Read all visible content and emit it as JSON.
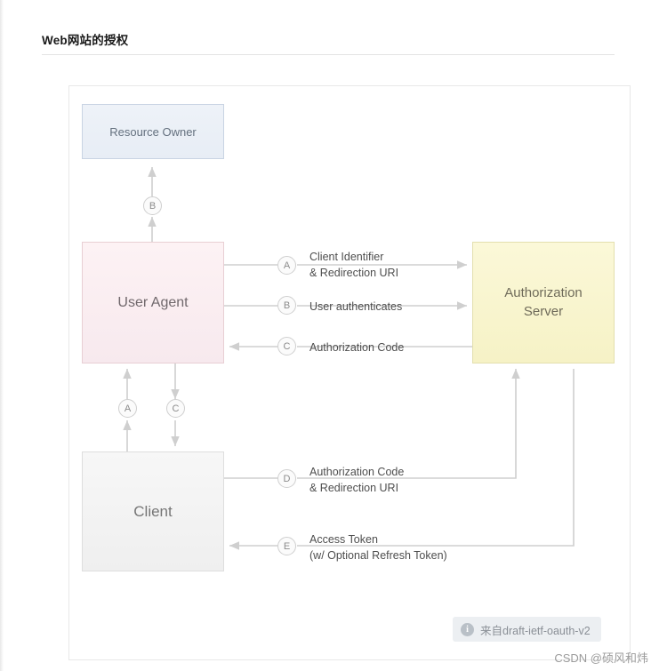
{
  "page": {
    "section_title": "Web网站的授权",
    "watermark": "CSDN @硕风和炜"
  },
  "diagram": {
    "boxes": [
      {
        "id": "resource-owner",
        "label": "Resource Owner"
      },
      {
        "id": "user-agent",
        "label": "User Agent"
      },
      {
        "id": "client",
        "label": "Client"
      },
      {
        "id": "authorization-server",
        "label": "Authorization\nServer"
      }
    ],
    "steps": [
      {
        "key": "A",
        "label": "Client Identifier\n& Redirection URI"
      },
      {
        "key": "B",
        "label": "User authenticates"
      },
      {
        "key": "C",
        "label": "Authorization Code"
      },
      {
        "key": "D",
        "label": "Authorization Code\n& Redirection URI"
      },
      {
        "key": "E",
        "label": "Access Token\n(w/ Optional Refresh Token)"
      }
    ],
    "markers": {
      "b_up": "B",
      "a_up": "A",
      "c_down": "C"
    },
    "source_badge": {
      "icon": "info-icon",
      "text": "来自draft-ietf-oauth-v2"
    }
  }
}
